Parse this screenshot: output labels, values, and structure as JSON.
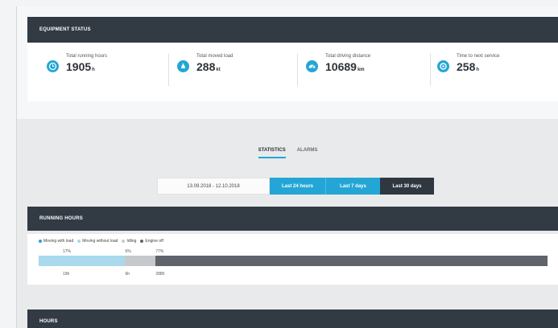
{
  "equipment_status": {
    "title": "EQUIPMENT STATUS",
    "kpis": [
      {
        "label": "Total running hours",
        "value": "1905",
        "unit": "h",
        "icon": "clock-icon"
      },
      {
        "label": "Total moved load",
        "value": "288",
        "unit": "kt",
        "icon": "weight-icon"
      },
      {
        "label": "Total driving distance",
        "value": "10689",
        "unit": "km",
        "icon": "speedometer-icon"
      },
      {
        "label": "Time to next service",
        "value": "258",
        "unit": "h",
        "icon": "service-icon"
      }
    ]
  },
  "tabs": [
    {
      "label": "STATISTICS",
      "active": true
    },
    {
      "label": "ALARMS",
      "active": false
    }
  ],
  "date_range": "13.09.2018 - 12.10.2018",
  "periods": [
    {
      "label": "Last 24 hours"
    },
    {
      "label": "Last 7 days"
    },
    {
      "label": "Last 30 days"
    }
  ],
  "running_hours": {
    "title": "RUNNING HOURS",
    "legend": [
      {
        "label": "Moving with load",
        "color": "#23a6d5"
      },
      {
        "label": "Moving without load",
        "color": "#a9d9ec"
      },
      {
        "label": "Idling",
        "color": "#c6c9cc"
      },
      {
        "label": "Engine off",
        "color": "#5f646b"
      }
    ],
    "segments": [
      {
        "name": "Moving without load",
        "percent": 17,
        "color": "#a9d9ec",
        "top_label": "17%",
        "bottom_label": "19h"
      },
      {
        "name": "Idling",
        "percent": 6,
        "color": "#c6c9cc",
        "top_label": "6%",
        "bottom_label": "6h"
      },
      {
        "name": "Engine off",
        "percent": 77,
        "color": "#5f646b",
        "top_label": "77%",
        "bottom_label": "288h"
      }
    ]
  },
  "next_section": {
    "title": "HOURS"
  },
  "colors": {
    "accent": "#23a6d5",
    "header_dark": "#323a44"
  }
}
